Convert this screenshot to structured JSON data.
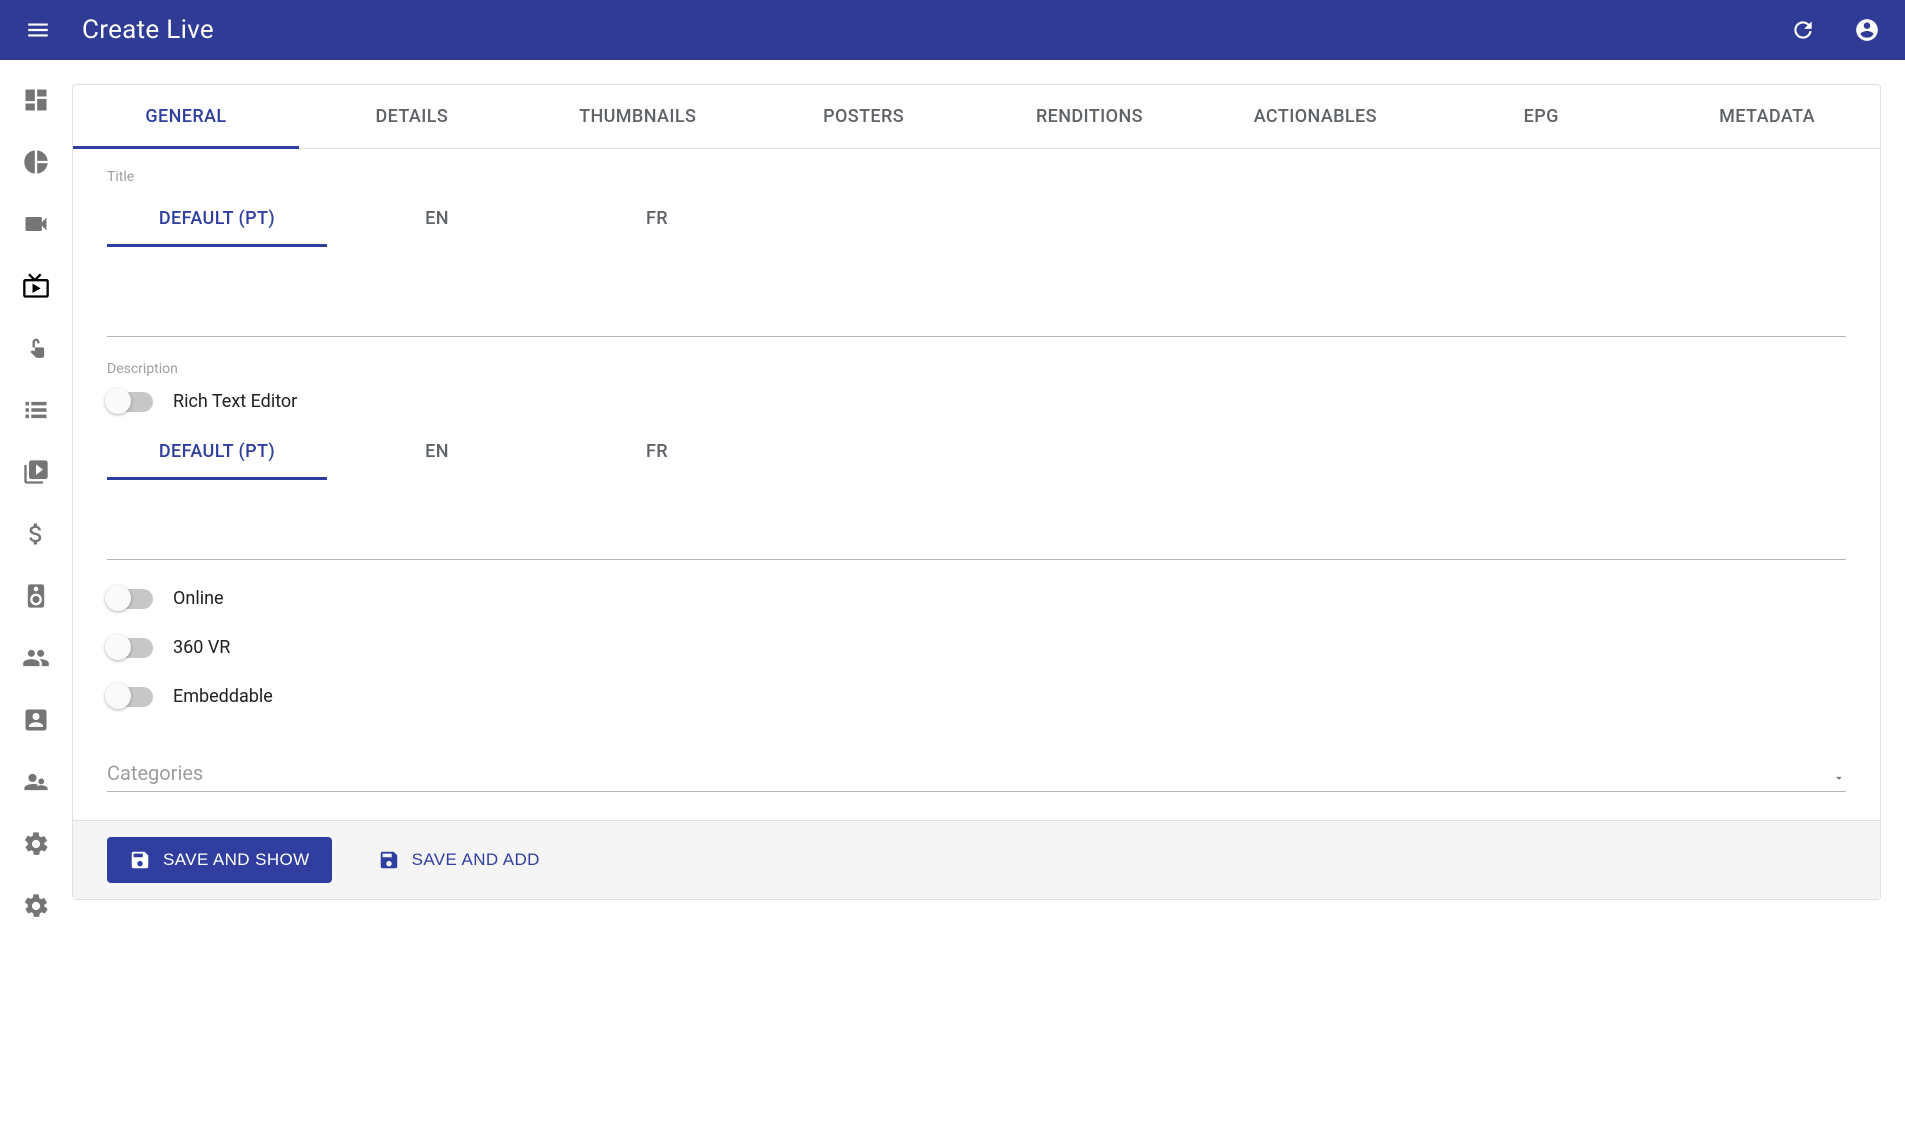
{
  "header": {
    "title": "Create Live"
  },
  "tabs": {
    "general": "GENERAL",
    "details": "DETAILS",
    "thumbnails": "THUMBNAILS",
    "posters": "POSTERS",
    "renditions": "RENDITIONS",
    "actionables": "ACTIONABLES",
    "epg": "EPG",
    "metadata": "METADATA"
  },
  "fields": {
    "title_label": "Title",
    "description_label": "Description",
    "categories_label": "Categories"
  },
  "lang_tabs": {
    "default": "DEFAULT (PT)",
    "en": "EN",
    "fr": "FR"
  },
  "toggles": {
    "rich_text": "Rich Text Editor",
    "online": "Online",
    "vr360": "360 VR",
    "embeddable": "Embeddable"
  },
  "actions": {
    "save_show": "SAVE AND SHOW",
    "save_add": "SAVE AND ADD"
  }
}
